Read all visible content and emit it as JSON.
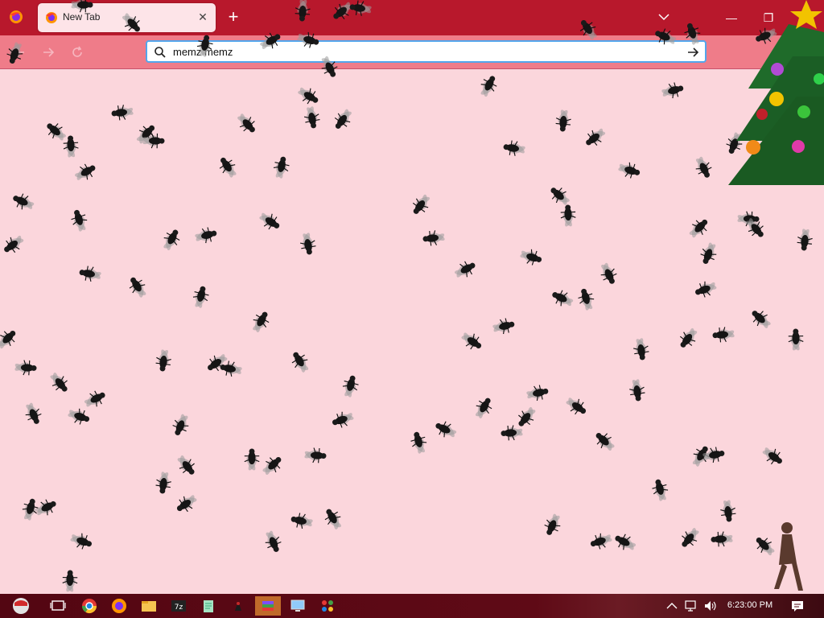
{
  "browser": {
    "tab_title": "New Tab",
    "new_tab_symbol": "+",
    "close_symbol": "✕",
    "address_value": "memz memz",
    "icons": [
      "firefox-icon",
      "back-arrow-icon",
      "forward-arrow-icon",
      "reload-icon",
      "search-icon",
      "go-arrow-icon",
      "chevron-down-icon",
      "minimize-icon",
      "restore-icon",
      "close-icon"
    ],
    "colors": {
      "titlebar": "#b8182c",
      "toolbar": "#ef7c89",
      "page": "#fbd6dc",
      "url_focus": "#53a6ec"
    }
  },
  "overlays": {
    "items": [
      "housefly-icon",
      "christmas-tree-icon",
      "star-icon",
      "walking-figure-icon"
    ]
  },
  "taskbar": {
    "apps": [
      "start-button-icon",
      "task-view-icon",
      "chrome-icon",
      "firefox-icon",
      "file-explorer-icon",
      "7zip-icon",
      "notepad-icon",
      "app-icon",
      "winrar-icon",
      "monitor-icon",
      "paint-icon"
    ],
    "clock": "6:23:00 PM",
    "tray_icons": [
      "chevron-up-icon",
      "network-icon",
      "speaker-icon",
      "notification-icon"
    ]
  }
}
